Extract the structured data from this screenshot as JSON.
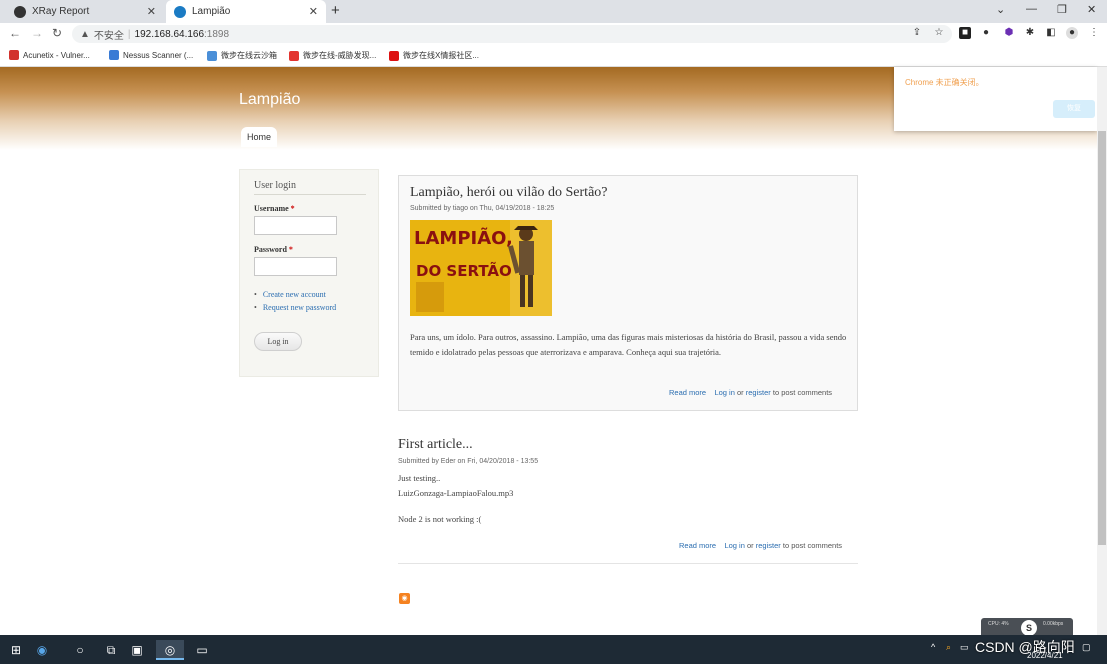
{
  "browser": {
    "tabs": [
      {
        "title": "XRay Report",
        "close": "✕"
      },
      {
        "title": "Lampião",
        "close": "✕"
      }
    ],
    "new_tab": "+",
    "window_controls": [
      "⌄",
      "—",
      "❐",
      "✕"
    ],
    "url": {
      "security_label": "不安全",
      "host": "192.168.64.166",
      "port": ":1898"
    },
    "bookmarks": [
      {
        "label": "Acunetix - Vulner...",
        "color": "#d2322d"
      },
      {
        "label": "Nessus Scanner (...",
        "color": "#3a7bd5"
      },
      {
        "label": "微步在线云沙箱",
        "color": "#4a8fd8"
      },
      {
        "label": "微步在线-威胁发现...",
        "color": "#e3342f"
      },
      {
        "label": "微步在线X情报社区...",
        "color": "#d11"
      }
    ]
  },
  "site": {
    "name": "Lampião",
    "nav": {
      "home": "Home"
    }
  },
  "login_block": {
    "title": "User login",
    "username_label": "Username",
    "password_label": "Password",
    "required_mark": "*",
    "links": [
      "Create new account",
      "Request new password"
    ],
    "button": "Log in"
  },
  "nodes": [
    {
      "title": "Lampião, herói ou vilão do Sertão?",
      "submitted": "Submitted by tiago on Thu, 04/19/2018 - 18:25",
      "image_text": [
        "LAMPIÃO,",
        "DO SERTÃO"
      ],
      "body": "Para uns, um ídolo. Para outros, assassino. Lampião, uma das figuras mais misteriosas da história do Brasil, passou a vida sendo temido e idolatrado pelas pessoas que aterrorizava e amparava. Conheça aqui sua trajetória.",
      "read_more": "Read more",
      "log_in": "Log in",
      "or": "or",
      "register": "register",
      "post_comments": "to post comments"
    },
    {
      "title": "First article...",
      "submitted": "Submitted by Eder on Fri, 04/20/2018 - 13:55",
      "lines": [
        "Just testing..",
        "LuizGonzaga-LampiaoFalou.mp3",
        "Node 2 is not working :("
      ],
      "read_more": "Read more",
      "log_in": "Log in",
      "or": "or",
      "register": "register",
      "post_comments": "to post comments"
    }
  ],
  "toast": {
    "message": "Chrome 未正确关闭。",
    "button": "恢复"
  },
  "taskbar": {
    "watermark": "CSDN @路向阳",
    "date": "2022/4/21",
    "widget": {
      "cpu": "CPU: 4%",
      "mem": "内存: 正常",
      "badge": "S",
      "speed": "0.00kbps"
    }
  }
}
